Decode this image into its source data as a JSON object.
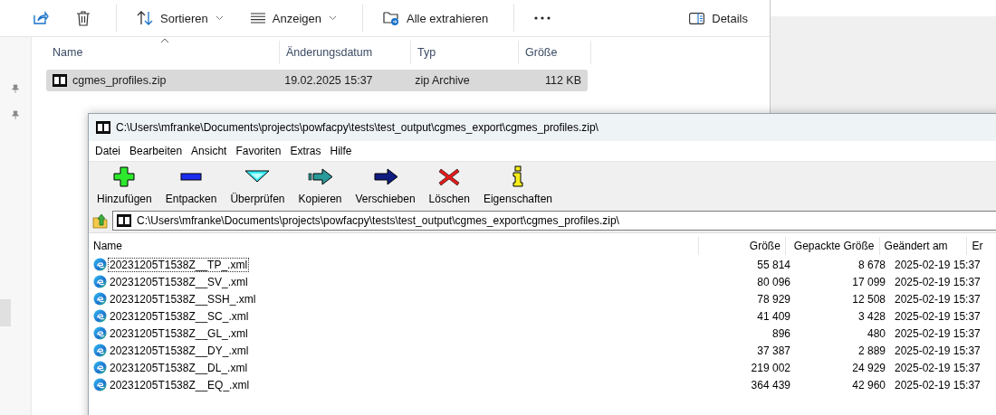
{
  "explorer": {
    "toolbar": [
      {
        "kind": "share"
      },
      {
        "kind": "delete"
      },
      {
        "kind": "divider"
      },
      {
        "kind": "sort",
        "label": "Sortieren",
        "dropdown": true
      },
      {
        "kind": "view",
        "label": "Anzeigen",
        "dropdown": true
      },
      {
        "kind": "divider"
      },
      {
        "kind": "extract",
        "label": "Alle extrahieren"
      },
      {
        "kind": "divider"
      },
      {
        "kind": "more"
      }
    ],
    "details_button": {
      "label": "Details"
    },
    "columns": [
      {
        "label": "Name",
        "sorted": true
      },
      {
        "label": "Änderungsdatum",
        "sorted": false
      },
      {
        "label": "Typ",
        "sorted": false
      },
      {
        "label": "Größe",
        "sorted": false
      }
    ],
    "rows": [
      {
        "name": "cgmes_profiles.zip",
        "modified": "19.02.2025 15:37",
        "type": "zip Archive",
        "size": "112 KB",
        "selected": true
      }
    ]
  },
  "sevenzip": {
    "title": "C:\\Users\\mfranke\\Documents\\projects\\powfacpy\\tests\\test_output\\cgmes_export\\cgmes_profiles.zip\\",
    "menu": [
      "Datei",
      "Bearbeiten",
      "Ansicht",
      "Favoriten",
      "Extras",
      "Hilfe"
    ],
    "toolbar": [
      {
        "kind": "add",
        "label": "Hinzufügen"
      },
      {
        "kind": "extract",
        "label": "Entpacken"
      },
      {
        "kind": "test",
        "label": "Überprüfen"
      },
      {
        "kind": "copy",
        "label": "Kopieren"
      },
      {
        "kind": "move",
        "label": "Verschieben"
      },
      {
        "kind": "delete",
        "label": "Löschen"
      },
      {
        "kind": "info",
        "label": "Eigenschaften"
      }
    ],
    "address": "C:\\Users\\mfranke\\Documents\\projects\\powfacpy\\tests\\test_output\\cgmes_export\\cgmes_profiles.zip\\",
    "columns": [
      "Name",
      "Größe",
      "Gepackte Größe",
      "Geändert am",
      "Er"
    ],
    "rows": [
      {
        "name": "20231205T1538Z__TP_.xml",
        "size": "55 814",
        "packed": "8 678",
        "modified": "2025-02-19 15:37",
        "focused": true
      },
      {
        "name": "20231205T1538Z__SV_.xml",
        "size": "80 096",
        "packed": "17 099",
        "modified": "2025-02-19 15:37",
        "focused": false
      },
      {
        "name": "20231205T1538Z__SSH_.xml",
        "size": "78 929",
        "packed": "12 508",
        "modified": "2025-02-19 15:37",
        "focused": false
      },
      {
        "name": "20231205T1538Z__SC_.xml",
        "size": "41 409",
        "packed": "3 428",
        "modified": "2025-02-19 15:37",
        "focused": false
      },
      {
        "name": "20231205T1538Z__GL_.xml",
        "size": "896",
        "packed": "480",
        "modified": "2025-02-19 15:37",
        "focused": false
      },
      {
        "name": "20231205T1538Z__DY_.xml",
        "size": "37 387",
        "packed": "2 889",
        "modified": "2025-02-19 15:37",
        "focused": false
      },
      {
        "name": "20231205T1538Z__DL_.xml",
        "size": "219 002",
        "packed": "24 929",
        "modified": "2025-02-19 15:37",
        "focused": false
      },
      {
        "name": "20231205T1538Z__EQ_.xml",
        "size": "364 439",
        "packed": "42 960",
        "modified": "2025-02-19 15:37",
        "focused": false
      }
    ]
  }
}
